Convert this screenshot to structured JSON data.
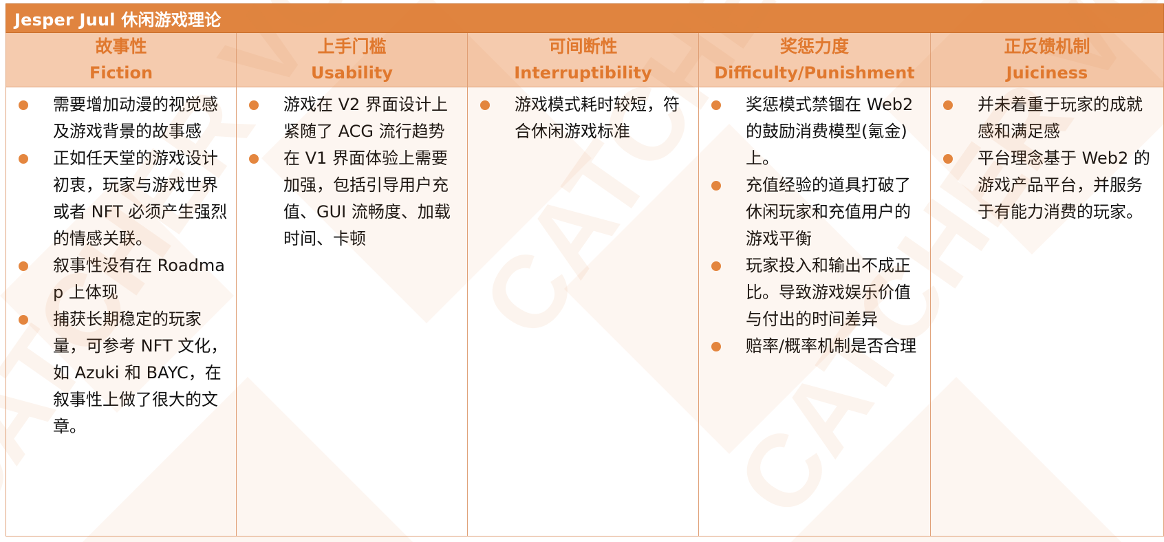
{
  "title": "Jesper Juul  休闲游戏理论",
  "colors": {
    "header_bar": "#E0843F",
    "column_header_bg": "#F5CBAE",
    "column_header_text": "#E0782E",
    "bullet": "#E4863F",
    "border": "#E0A27A"
  },
  "columns": [
    {
      "title_zh": "故事性",
      "title_en": "Fiction",
      "bullets": [
        "需要增加动漫的视觉感及游戏背景的故事感",
        "正如任天堂的游戏设计初衷，玩家与游戏世界或者 NFT 必须产生强烈的情感关联。",
        "叙事性没有在 Roadmap 上体现",
        "捕获长期稳定的玩家量，可参考 NFT 文化，如 Azuki 和 BAYC，在叙事性上做了很大的文章。"
      ]
    },
    {
      "title_zh": "上手门槛",
      "title_en": "Usability",
      "bullets": [
        "游戏在 V2 界面设计上紧随了 ACG 流行趋势",
        "在 V1 界面体验上需要加强，包括引导用户充值、GUI 流畅度、加载时间、卡顿"
      ]
    },
    {
      "title_zh": "可间断性",
      "title_en": "Interruptibility",
      "bullets": [
        "游戏模式耗时较短，符合休闲游戏标准"
      ]
    },
    {
      "title_zh": "奖惩力度",
      "title_en": "Difficulty/Punishment",
      "bullets": [
        "奖惩模式禁锢在 Web2 的鼓励消费模型(氪金)上。",
        "充值经验的道具打破了休闲玩家和充值用户的游戏平衡",
        "玩家投入和输出不成正比。导致游戏娱乐价值与付出的时间差异",
        "赔率/概率机制是否合理"
      ]
    },
    {
      "title_zh": "正反馈机制",
      "title_en": "Juiciness",
      "bullets": [
        "并未着重于玩家的成就感和满足感",
        "平台理念基于 Web2 的游戏产品平台，并服务于有能力消费的玩家。"
      ]
    }
  ],
  "watermark": {
    "text": "CATCHER VC"
  }
}
